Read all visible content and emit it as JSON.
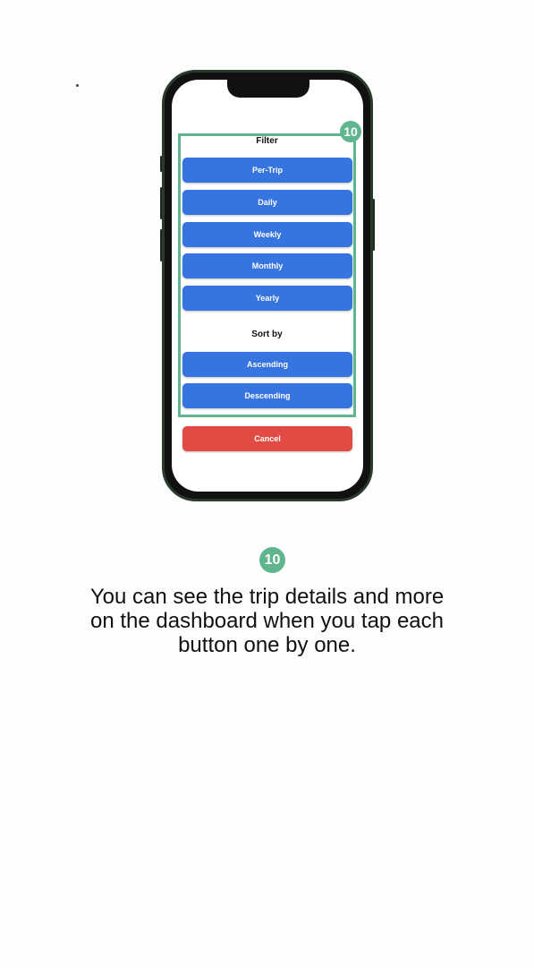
{
  "step_number": "10",
  "filter": {
    "title": "Filter",
    "options": [
      "Per-Trip",
      "Daily",
      "Weekly",
      "Monthly",
      "Yearly"
    ]
  },
  "sort": {
    "title": "Sort by",
    "options": [
      "Ascending",
      "Descending"
    ]
  },
  "cancel_label": "Cancel",
  "caption": "You can see the trip details and more on the dashboard when you tap each button one by one.",
  "colors": {
    "primary_button": "#3674e0",
    "cancel_button": "#e24b43",
    "highlight": "#5fb58e"
  }
}
